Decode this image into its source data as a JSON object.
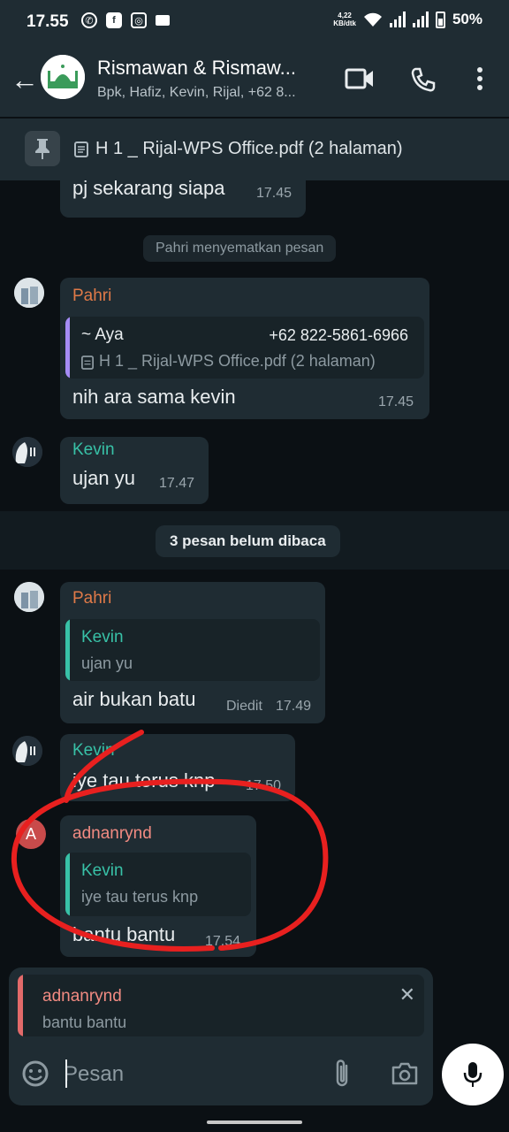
{
  "status_bar": {
    "time": "17.55",
    "net_speed_value": "4,22",
    "net_speed_unit": "KB/dtk",
    "battery": "50%",
    "icons": [
      "whatsapp-icon",
      "facebook-icon",
      "instagram-icon",
      "video-icon",
      "wifi-icon",
      "signal-icon",
      "signal-icon",
      "battery-icon"
    ]
  },
  "header": {
    "title": "Rismawan & Rismaw...",
    "subtitle": "Bpk, Hafiz, Kevin, Rijal, +62 8...",
    "icons": [
      "back-arrow-icon",
      "video-call-icon",
      "phone-icon",
      "more-vert-icon"
    ]
  },
  "pinned": {
    "text": "H 1 _ Rijal-WPS Office.pdf (2 halaman)"
  },
  "messages": {
    "m0": {
      "text": "pj sekarang siapa",
      "time": "17.45"
    },
    "sys1": "Pahri menyematkan pesan",
    "m1": {
      "sender": "Pahri",
      "quote_name": "~ Aya",
      "quote_phone": "+62 822-5861-6966",
      "quote_text": "H 1 _ Rijal-WPS Office.pdf (2 halaman)",
      "text": "nih ara sama kevin",
      "time": "17.45"
    },
    "m2": {
      "sender": "Kevin",
      "text": "ujan yu",
      "time": "17.47"
    },
    "unread": "3 pesan belum dibaca",
    "m3": {
      "sender": "Pahri",
      "quote_name": "Kevin",
      "quote_text": "ujan yu",
      "text": "air bukan batu",
      "edited": "Diedit",
      "time": "17.49"
    },
    "m4": {
      "sender": "Kevin",
      "text": "iye tau terus knp",
      "time": "17.50"
    },
    "m5": {
      "avatar_letter": "A",
      "sender": "adnanrynd",
      "quote_name": "Kevin",
      "quote_text": "iye tau terus knp",
      "text": "bantu bantu",
      "time": "17.54"
    }
  },
  "reply_preview": {
    "name": "adnanrynd",
    "text": "bantu bantu"
  },
  "composer": {
    "placeholder": "Pesan"
  },
  "colors": {
    "sender_pahri": "#e07a48",
    "sender_kevin": "#38c1a7",
    "sender_adnan": "#f28b82",
    "quote_aya_bar": "#a58cf5",
    "quote_kevin_bar": "#38c1a7",
    "annotation": "#e8201f"
  }
}
